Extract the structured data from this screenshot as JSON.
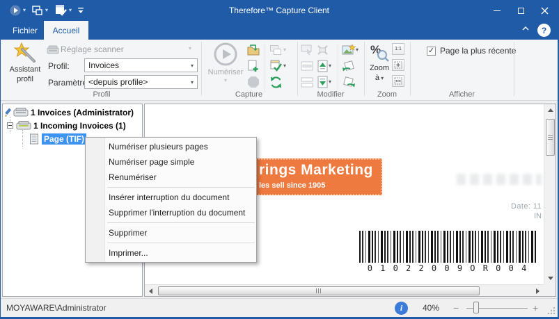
{
  "window": {
    "title": "Therefore™ Capture Client"
  },
  "tabs": [
    {
      "label": "Fichier"
    },
    {
      "label": "Accueil"
    }
  ],
  "ribbon": {
    "profil": {
      "assistant_line1": "Assistant",
      "assistant_line2": "profil",
      "reglage_scanner": "Réglage scanner",
      "profil_label": "Profil:",
      "profil_value": "Invoices",
      "parametre_label": "Paramètre:",
      "parametre_value": "<depuis profile>",
      "group_label": "Profil"
    },
    "capture": {
      "numeriser": "Numériser",
      "group_label": "Capture"
    },
    "modifier": {
      "group_label": "Modifier"
    },
    "zoom": {
      "zoom_a_line1": "Zoom",
      "zoom_a_line2": "à",
      "one_to_one": "1:1",
      "group_label": "Zoom"
    },
    "afficher": {
      "checkbox_label": "Page la plus récente",
      "checked": true,
      "group_label": "Afficher"
    }
  },
  "tree": {
    "items": [
      {
        "label": "1 Invoices (Administrator)"
      },
      {
        "label": "1 Incoming Invoices (1)"
      },
      {
        "label": "Page (TIF)",
        "selected": true
      }
    ]
  },
  "context_menu": {
    "items": [
      {
        "label": "Numériser plusieurs pages"
      },
      {
        "label": "Numériser page simple"
      },
      {
        "label": "Renumériser"
      },
      {
        "label": "Insérer interruption du document"
      },
      {
        "label": "Supprimer l'interruption du document"
      },
      {
        "label": "Supprimer"
      },
      {
        "label": "Imprimer..."
      }
    ]
  },
  "document": {
    "banner_title": "rings Marketing",
    "banner_subtitle": "les sell since 1905",
    "date_text": "Date: 11",
    "date_text2": "IN",
    "barcode_digits": "0 1 0 2 2 0 0 9 O R 0 0 4"
  },
  "status_bar": {
    "user": "MOYAWARE\\Administrator",
    "zoom_percent": "40%"
  },
  "colors": {
    "titlebar_blue": "#1f5ba6",
    "selection_blue": "#3d93ef",
    "banner_orange": "#ef7a3f",
    "accent_green": "#26a056",
    "ribbon_bg": "#f4f5f6",
    "status_bg": "#f0f0f0"
  }
}
